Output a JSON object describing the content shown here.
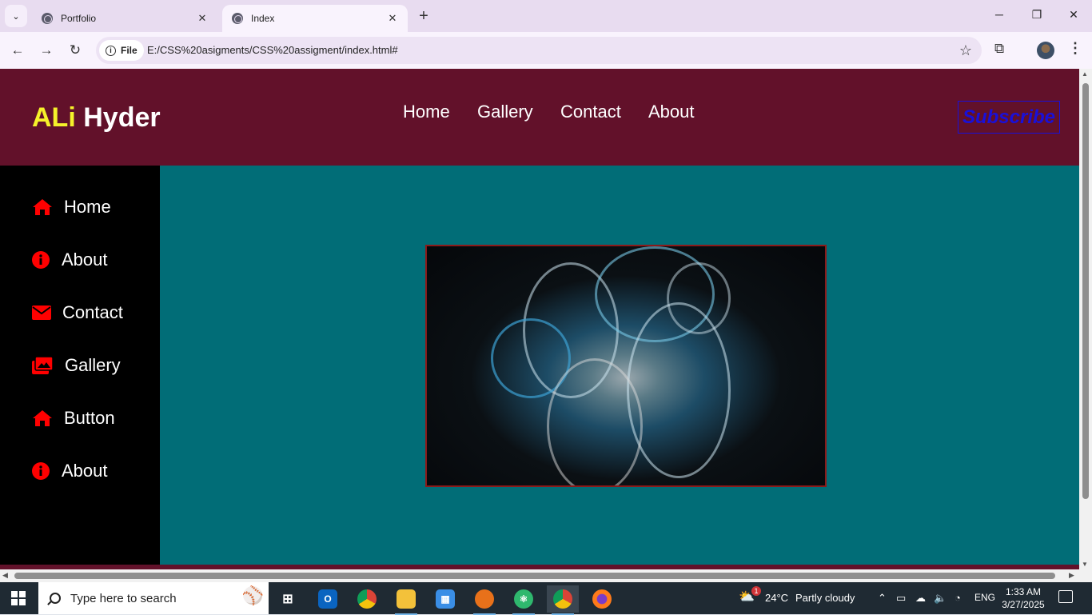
{
  "browser": {
    "tabs": [
      {
        "title": "Portfolio",
        "active": false
      },
      {
        "title": "Index",
        "active": true
      }
    ],
    "address": {
      "scheme_label": "File",
      "url": "E:/CSS%20asigments/CSS%20assigment/index.html#"
    }
  },
  "site": {
    "logo_first": "ALi",
    "logo_second": "Hyder",
    "nav": [
      "Home",
      "Gallery",
      "Contact",
      "About"
    ],
    "subscribe_label": "Subscribe",
    "sidebar": [
      {
        "label": "Home",
        "icon": "home-icon"
      },
      {
        "label": "About",
        "icon": "info-icon"
      },
      {
        "label": "Contact",
        "icon": "envelope-icon"
      },
      {
        "label": "Gallery",
        "icon": "images-icon"
      },
      {
        "label": "Button",
        "icon": "home-icon"
      },
      {
        "label": "About",
        "icon": "info-icon"
      }
    ],
    "colors": {
      "header": "#62112a",
      "main": "#016d77",
      "sidebar": "#000000",
      "logo_accent": "#f6f22a",
      "icon_red": "#ff0000",
      "subscribe_blue": "#1a10d8"
    }
  },
  "taskbar": {
    "search_placeholder": "Type here to search",
    "weather_temp": "24°C",
    "weather_desc": "Partly cloudy",
    "weather_badge": "1",
    "language": "ENG",
    "time": "1:33 AM",
    "date": "3/27/2025"
  }
}
